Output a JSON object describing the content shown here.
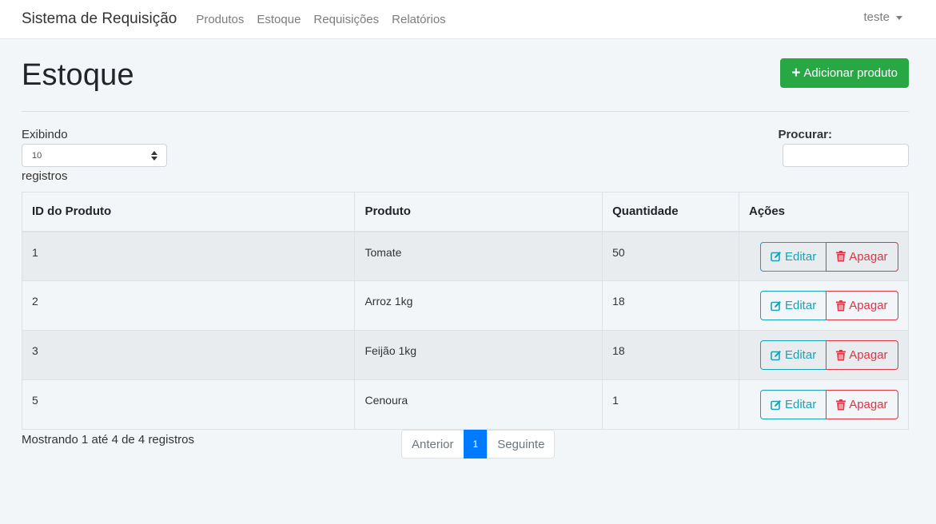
{
  "navbar": {
    "brand": "Sistema de Requisição",
    "links": [
      "Produtos",
      "Estoque",
      "Requisições",
      "Relatórios"
    ],
    "user": "teste"
  },
  "page": {
    "title": "Estoque",
    "add_button": "Adicionar produto"
  },
  "length_control": {
    "label": "Exibindo",
    "value": "10",
    "suffix": "registros"
  },
  "search": {
    "label": "Procurar:",
    "value": ""
  },
  "table": {
    "headers": [
      "ID do Produto",
      "Produto",
      "Quantidade",
      "Ações"
    ],
    "rows": [
      {
        "id": "1",
        "product": "Tomate",
        "quantity": "50"
      },
      {
        "id": "2",
        "product": "Arroz 1kg",
        "quantity": "18"
      },
      {
        "id": "3",
        "product": "Feijão 1kg",
        "quantity": "18"
      },
      {
        "id": "5",
        "product": "Cenoura",
        "quantity": "1"
      }
    ],
    "edit_label": "Editar",
    "delete_label": "Apagar"
  },
  "footer": {
    "info": "Mostrando 1 até 4 de 4 registros",
    "pagination": {
      "prev": "Anterior",
      "current": "1",
      "next": "Seguinte"
    }
  },
  "colors": {
    "accent_green": "#28a745",
    "edit_teal": "#17a2b8",
    "delete_red": "#dc3545",
    "page_active_blue": "#007bff"
  }
}
